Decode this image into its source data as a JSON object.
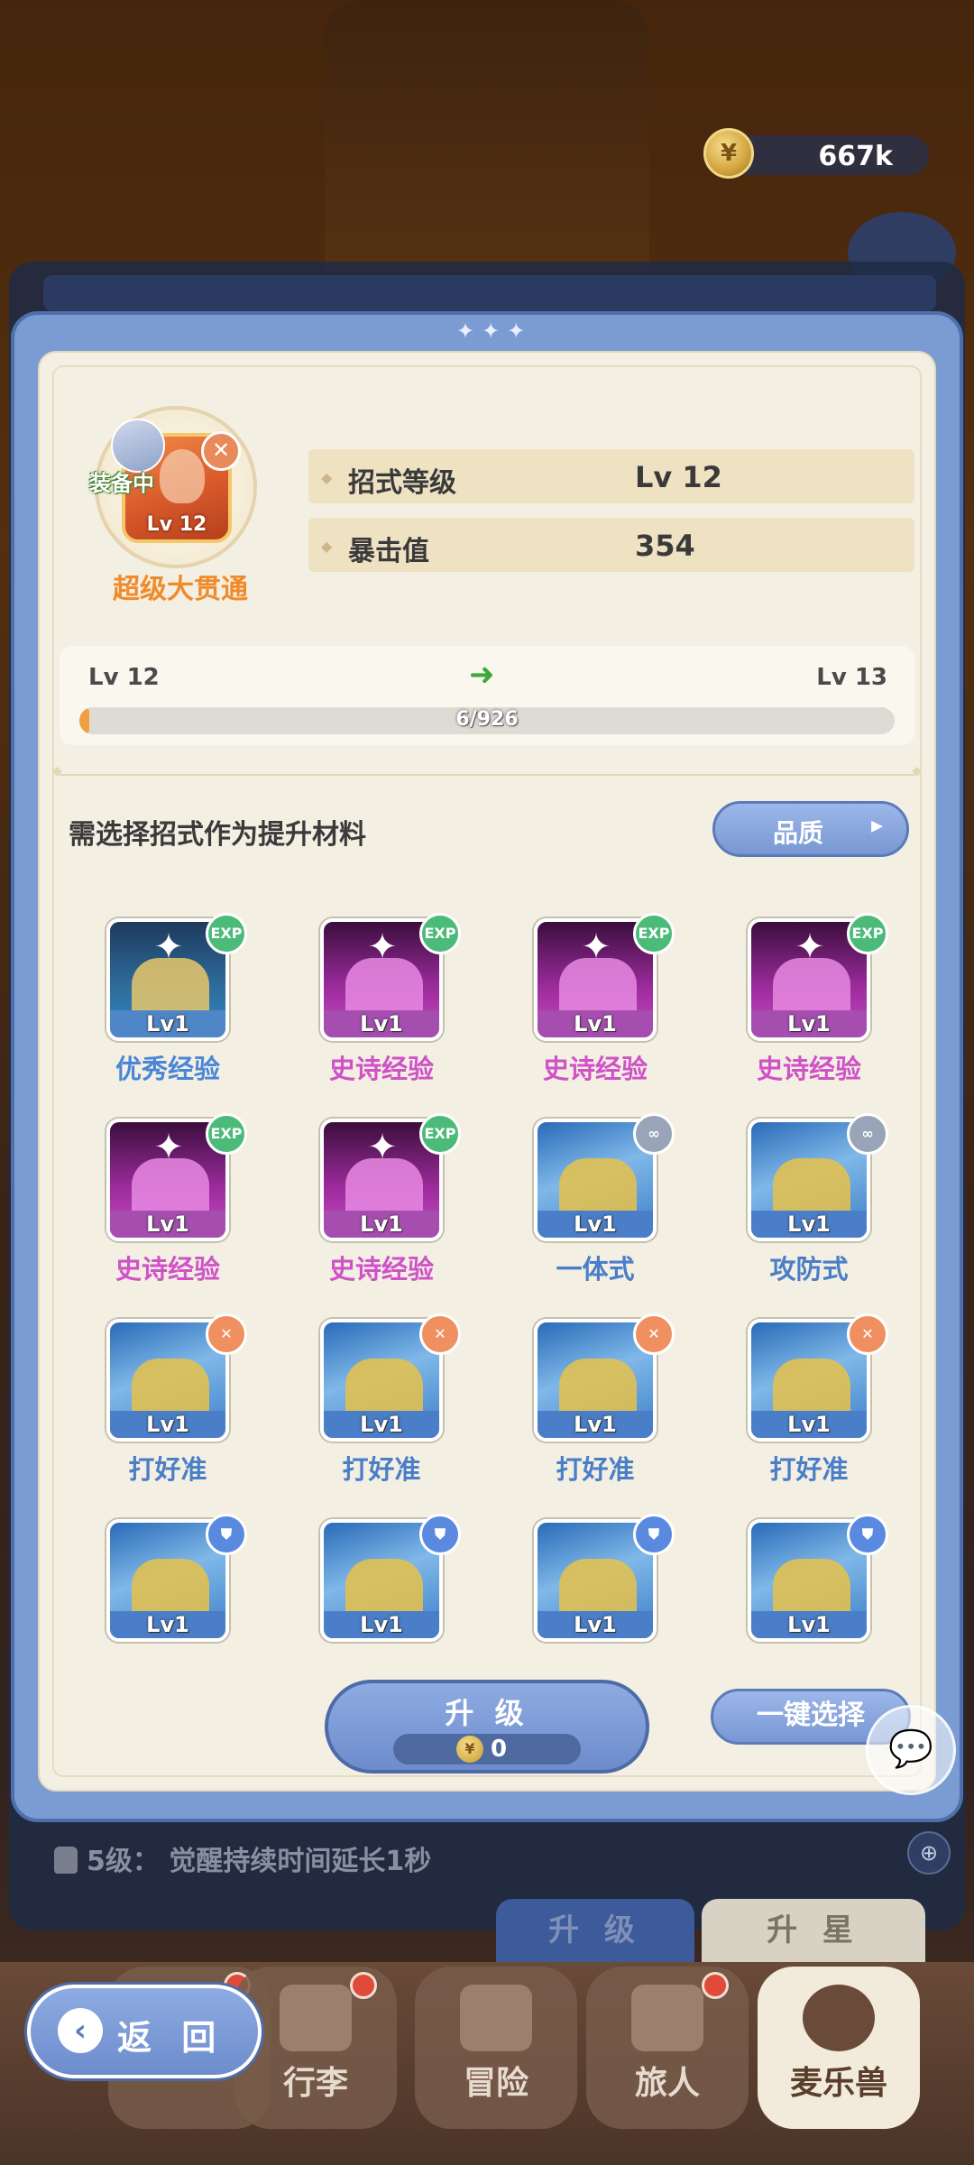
{
  "currency": {
    "value": "667k"
  },
  "skill": {
    "equip_tag": "装备中",
    "level_badge": "Lv 12",
    "name": "超级大贯通",
    "stats": [
      {
        "label": "招式等级",
        "value": "Lv 12"
      },
      {
        "label": "暴击值",
        "value": "354"
      }
    ]
  },
  "progress": {
    "from": "Lv 12",
    "to": "Lv 13",
    "text": "6/926",
    "current": 6,
    "max": 926,
    "accent": "#f0a040"
  },
  "material": {
    "hint": "需选择招式作为提升材料",
    "quality_button": "品质"
  },
  "grid": {
    "items": [
      {
        "level": "Lv1",
        "name": "优秀经验",
        "style": "blue",
        "corner": "EXP",
        "icon": "exp-icon"
      },
      {
        "level": "Lv1",
        "name": "史诗经验",
        "style": "purple",
        "corner": "EXP",
        "icon": "exp-icon"
      },
      {
        "level": "Lv1",
        "name": "史诗经验",
        "style": "purple",
        "corner": "EXP",
        "icon": "exp-icon"
      },
      {
        "level": "Lv1",
        "name": "史诗经验",
        "style": "purple",
        "corner": "EXP",
        "icon": "exp-icon"
      },
      {
        "level": "Lv1",
        "name": "史诗经验",
        "style": "purple",
        "corner": "EXP",
        "icon": "exp-icon"
      },
      {
        "level": "Lv1",
        "name": "史诗经验",
        "style": "purple",
        "corner": "EXP",
        "icon": "exp-icon"
      },
      {
        "level": "Lv1",
        "name": "一体式",
        "style": "gold",
        "corner": "",
        "icon": "link-icon"
      },
      {
        "level": "Lv1",
        "name": "攻防式",
        "style": "gold",
        "corner": "",
        "icon": "link-icon"
      },
      {
        "level": "Lv1",
        "name": "打好准",
        "style": "gold",
        "corner": "",
        "icon": "sword-icon"
      },
      {
        "level": "Lv1",
        "name": "打好准",
        "style": "gold",
        "corner": "",
        "icon": "sword-icon"
      },
      {
        "level": "Lv1",
        "name": "打好准",
        "style": "gold",
        "corner": "",
        "icon": "sword-icon"
      },
      {
        "level": "Lv1",
        "name": "打好准",
        "style": "gold",
        "corner": "",
        "icon": "sword-icon"
      },
      {
        "level": "Lv1",
        "name": "",
        "style": "gold",
        "corner": "",
        "icon": "shield-icon"
      },
      {
        "level": "Lv1",
        "name": "",
        "style": "gold",
        "corner": "",
        "icon": "shield-icon"
      },
      {
        "level": "Lv1",
        "name": "",
        "style": "gold",
        "corner": "",
        "icon": "shield-icon"
      },
      {
        "level": "Lv1",
        "name": "",
        "style": "gold",
        "corner": "",
        "icon": "shield-icon"
      }
    ]
  },
  "actions": {
    "upgrade_label": "升 级",
    "upgrade_cost": "0",
    "auto_select": "一键选择"
  },
  "behind": {
    "level_hint": "5级：  觉醒持续时间延长1秒",
    "tab_upgrade": "升 级",
    "tab_star": "升 星"
  },
  "nav": {
    "back": "返 回",
    "items": [
      {
        "label": "",
        "dot": true
      },
      {
        "label": "行李",
        "dot": true
      },
      {
        "label": "冒险",
        "dot": false
      },
      {
        "label": "旅人",
        "dot": true
      },
      {
        "label": "麦乐兽",
        "dot": false
      }
    ]
  }
}
